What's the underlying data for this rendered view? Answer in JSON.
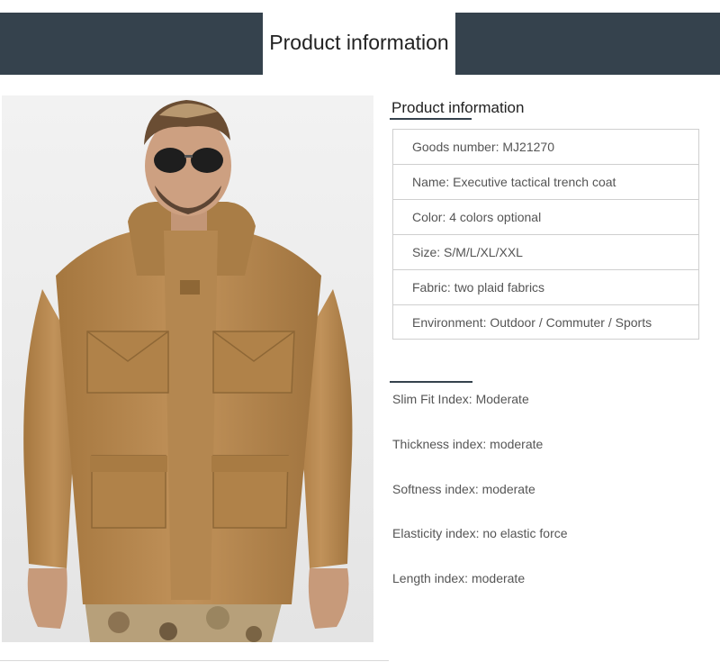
{
  "banner": {
    "title": "Product information"
  },
  "photo": {
    "alt": "Model wearing a khaki hooded tactical jacket with sunglasses"
  },
  "product_info": {
    "heading": "Product information",
    "rows": [
      "Goods number: MJ21270",
      "Name: Executive tactical trench coat",
      "Color: 4 colors optional",
      "Size: S/M/L/XL/XXL",
      "Fabric: two plaid fabrics",
      "Environment: Outdoor / Commuter / Sports"
    ]
  },
  "indices": [
    "Slim Fit Index: Moderate",
    "Thickness index: moderate",
    "Softness index: moderate",
    "Elasticity index: no elastic force",
    "Length index: moderate"
  ],
  "colors": {
    "banner": "#35424d",
    "jacket": "#b8894f",
    "background": "#ffffff"
  }
}
